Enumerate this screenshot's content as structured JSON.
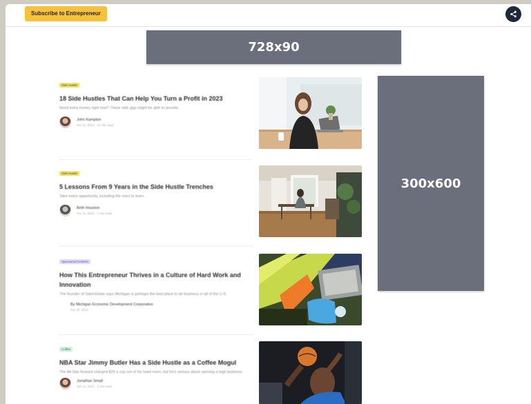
{
  "header": {
    "subscribe_label": "Subscribe to Entrepreneur",
    "share_icon": "share-icon"
  },
  "ads": {
    "leaderboard": "728x90",
    "skyscraper": "300x600"
  },
  "articles": [
    {
      "category": "Side Hustle",
      "headline": "18 Side Hustles That Can Help You Turn a Profit in 2023",
      "dek": "Need extra money right now? These side gigs might be able to provide.",
      "author": "John Kampton",
      "date": "Oct 11, 2023 · 12 min read"
    },
    {
      "category": "Side Hustle",
      "headline": "5 Lessons From 9 Years in the Side Hustle Trenches",
      "dek": "Take every opportunity, including the ones to learn.",
      "author": "Beth Houston",
      "date": "Oct 11, 2023 · 1 min read"
    },
    {
      "category": "Sponsored Content",
      "headline": "How This Entrepreneur Thrives in a Culture of Hard Work and Innovation",
      "dek": "The founder of SalonGlobe says Michigan is perhaps the best place to do business in all of the U.S.",
      "author": "By Michigan Economic Development Corporation",
      "date": "Oct 10, 2023"
    },
    {
      "category": "Coffee",
      "headline": "NBA Star Jimmy Butler Has a Side Hustle as a Coffee Mogul",
      "dek": "The All-Star forward charged $20 a cup out of his hotel room, but he's serious about opening a legit business.",
      "author": "Jonathan Small",
      "date": "Oct 10, 2023 · 2 min read"
    }
  ],
  "colors": {
    "subscribe_bg": "#f6c23c",
    "share_bg": "#1e2a3b",
    "ad_bg": "#6b6f7b"
  }
}
